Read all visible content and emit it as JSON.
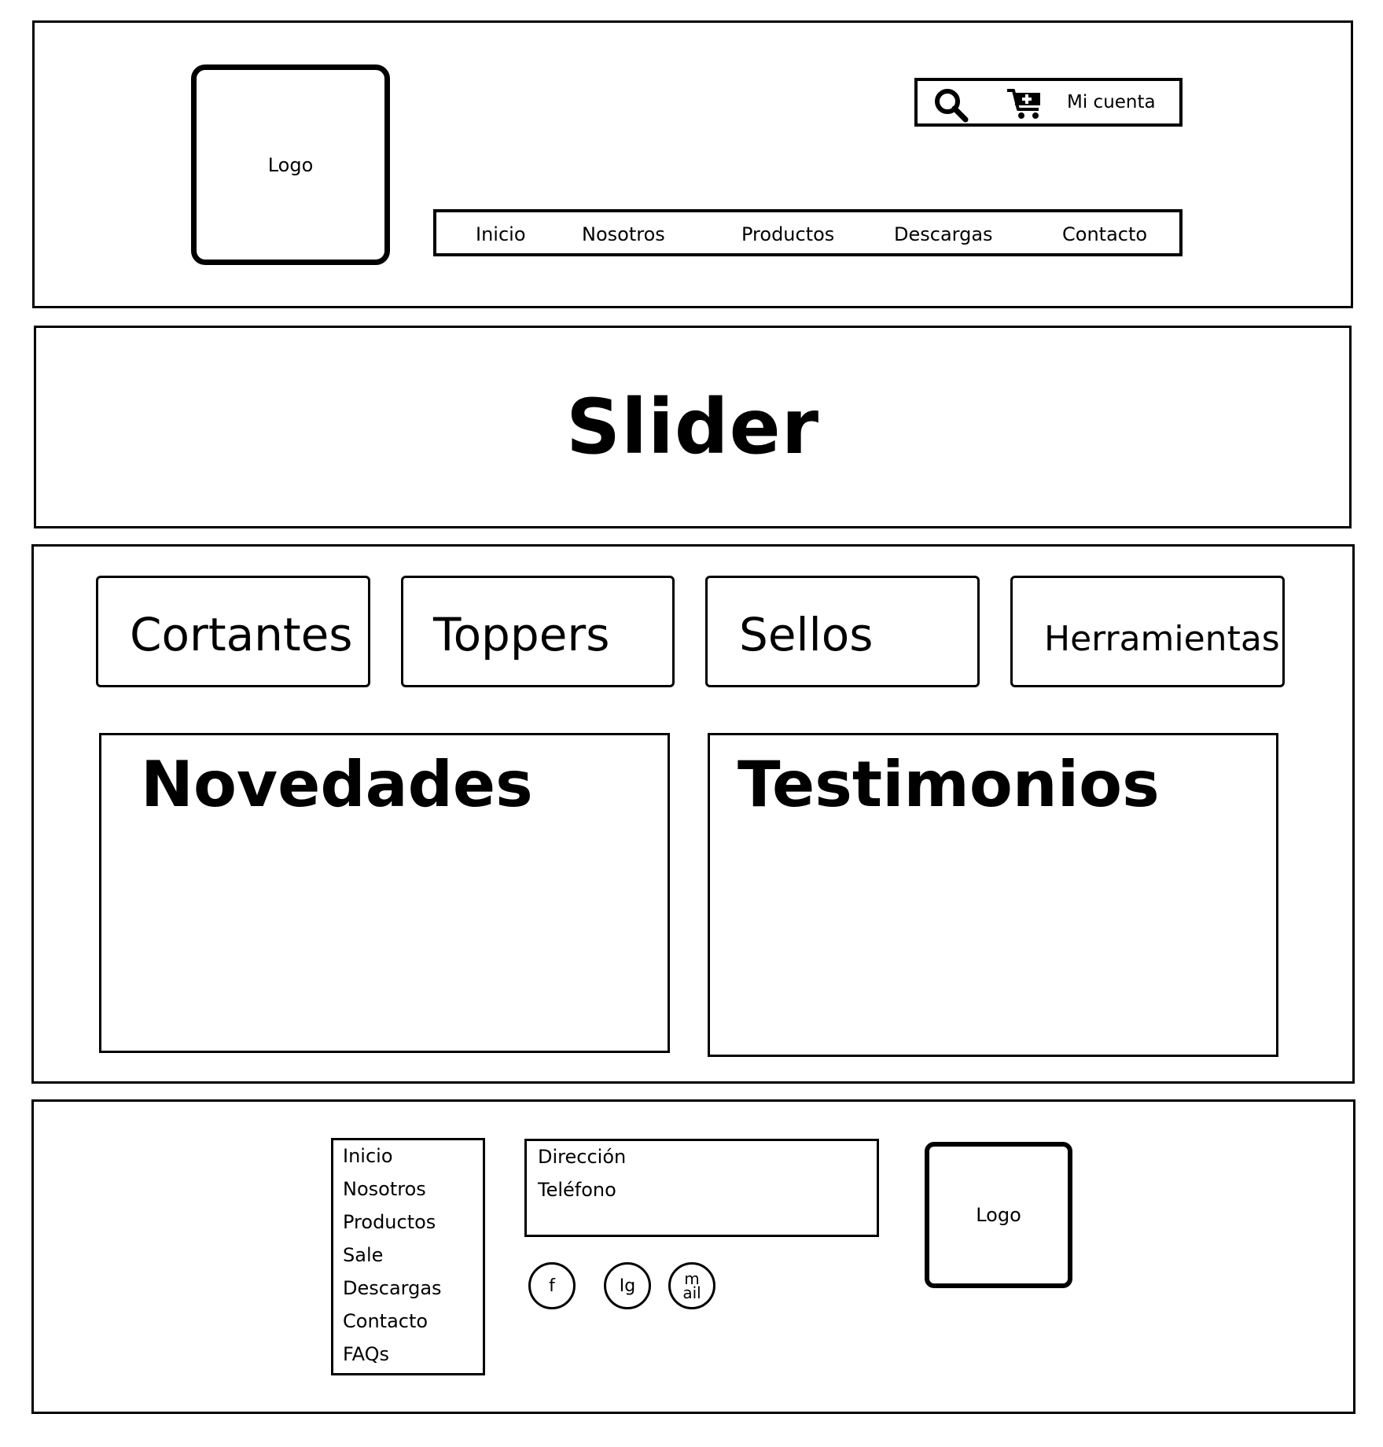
{
  "header": {
    "logo_label": "Logo",
    "utility": {
      "search_icon": "search-icon",
      "cart_icon": "cart-add-icon",
      "account_label": "Mi cuenta"
    },
    "nav": [
      "Inicio",
      "Nosotros",
      "Productos",
      "Descargas",
      "Contacto"
    ]
  },
  "slider": {
    "label": "Slider"
  },
  "categories": [
    "Cortantes",
    "Toppers",
    "Sellos",
    "Herramientas"
  ],
  "panels": {
    "novedades": "Novedades",
    "testimonios": "Testimonios"
  },
  "footer": {
    "links": [
      "Inicio",
      "Nosotros",
      "Productos",
      "Sale",
      "Descargas",
      "Contacto",
      "FAQs"
    ],
    "contact": {
      "address_label": "Dirección",
      "phone_label": "Teléfono"
    },
    "social": {
      "facebook": "f",
      "instagram": "Ig",
      "mail_top": "m",
      "mail_bottom": "ail"
    },
    "logo_label": "Logo"
  }
}
